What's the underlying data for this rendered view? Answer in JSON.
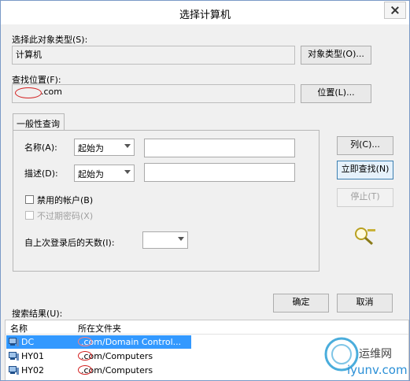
{
  "window": {
    "title": "选择计算机"
  },
  "object_type": {
    "label": "选择此对象类型(S):",
    "value": "计算机",
    "button": "对象类型(O)..."
  },
  "location": {
    "label": "查找位置(F):",
    "value": ".com",
    "button": "位置(L)..."
  },
  "tab": {
    "label": "一般性查询"
  },
  "query": {
    "name_label": "名称(A):",
    "name_operator": "起始为",
    "desc_label": "描述(D):",
    "desc_operator": "起始为",
    "disabled_accounts": "禁用的帐户(B)",
    "nonexpiring_pwd": "不过期密码(X)",
    "days_label": "自上次登录后的天数(I):"
  },
  "actions": {
    "columns": "列(C)...",
    "find_now": "立即查找(N)",
    "stop": "停止(T)",
    "ok": "确定",
    "cancel": "取消"
  },
  "results": {
    "label": "搜索结果(U):",
    "columns": [
      "名称",
      "所在文件夹"
    ],
    "rows": [
      {
        "name": "DC",
        "folder": ".com/Domain Control..."
      },
      {
        "name": "HY01",
        "folder": ".com/Computers"
      },
      {
        "name": "HY02",
        "folder": ".com/Computers"
      }
    ]
  },
  "watermark": {
    "text1": "运维网",
    "text2": "iyunv.com"
  }
}
